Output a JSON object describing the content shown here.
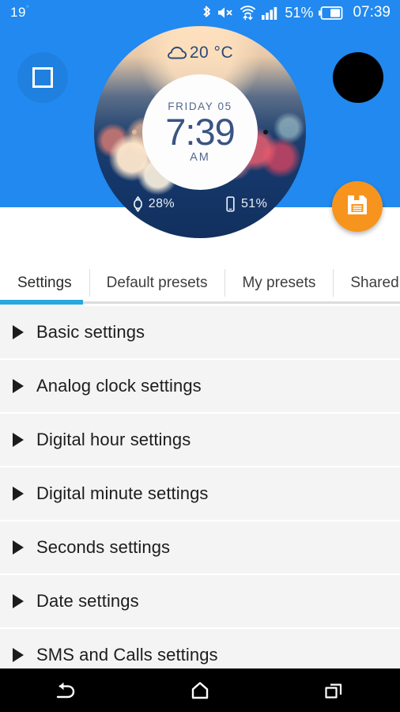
{
  "status_bar": {
    "temperature": "19",
    "degree_symbol": "°",
    "battery_percent": "51%",
    "clock": "07:39",
    "icons": [
      "bluetooth-icon",
      "volume-mute-icon",
      "wifi-icon",
      "signal-bars-icon",
      "battery-icon"
    ]
  },
  "header": {
    "background_color": "#2189ef",
    "shape_toggle": {
      "name": "square-shape-toggle",
      "icon": "square-icon"
    },
    "ambient_toggle": {
      "name": "ambient-black-toggle",
      "icon": "filled-circle-icon"
    },
    "save_fab": {
      "label": "Save",
      "icon": "floppy-disk-icon",
      "color": "#f7941d"
    }
  },
  "watch_preview": {
    "weather": {
      "icon": "cloud-icon",
      "temperature": "20 °C"
    },
    "date": "FRIDAY 05",
    "time": "7:39",
    "meridiem": "AM",
    "watch_battery": {
      "icon": "watch-icon",
      "value": "28%"
    },
    "phone_battery": {
      "icon": "phone-icon",
      "value": "51%"
    }
  },
  "tabs": {
    "active_color": "#29a8e0",
    "items": [
      {
        "label": "Settings",
        "active": true
      },
      {
        "label": "Default presets",
        "active": false
      },
      {
        "label": "My presets",
        "active": false
      },
      {
        "label": "Shared presets",
        "active": false
      }
    ]
  },
  "settings_list": {
    "items": [
      {
        "label": "Basic settings"
      },
      {
        "label": "Analog clock settings"
      },
      {
        "label": "Digital hour settings"
      },
      {
        "label": "Digital minute settings"
      },
      {
        "label": "Seconds settings"
      },
      {
        "label": "Date settings"
      },
      {
        "label": "SMS and Calls settings"
      }
    ]
  },
  "nav_bar": {
    "back": "back-icon",
    "home": "home-icon",
    "recents": "recents-icon"
  }
}
